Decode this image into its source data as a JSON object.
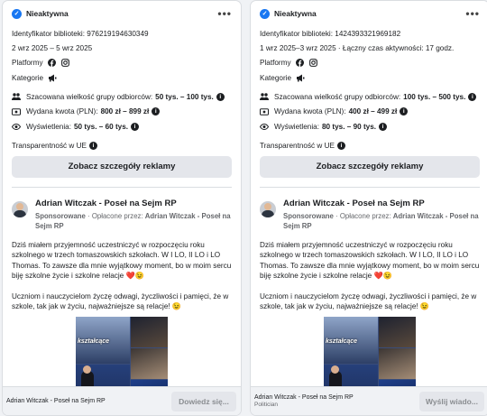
{
  "cards": [
    {
      "status": "Nieaktywna",
      "menu_label": "•••",
      "library_id": "Identyfikator biblioteki: 976219194630349",
      "dates": "2 wrz 2025 – 5 wrz 2025",
      "platforms_label": "Platformy",
      "categories_label": "Kategorie",
      "audience_label": "Szacowana wielkość grupy odbiorców:",
      "audience_value": "50 tys. – 100 tys.",
      "spend_label": "Wydana kwota (PLN):",
      "spend_value": "800 zł – 899 zł",
      "impressions_label": "Wyświetlenia:",
      "impressions_value": "50 tys. – 60 tys.",
      "transparency_label": "Transparentność w UE",
      "details_button": "Zobacz szczegóły reklamy",
      "post": {
        "author": "Adrian Witczak - Poseł na Sejm RP",
        "sponsored": "Sponsorowane",
        "paid_by_prefix": " · Opłacone przez: ",
        "paid_by": "Adrian Witczak - Poseł na Sejm RP",
        "paragraph1": "Dziś miałem przyjemność uczestniczyć w rozpoczęciu roku szkolnego w trzech tomaszowskich szkołach. W I LO, II LO i LO Thomas. To zawsze dla mnie wyjątkowy moment, bo w moim sercu biję szkolne życie i szkolne relacje ❤️😉",
        "paragraph2": "Uczniom i nauczycielom życzę odwagi, życzliwości i pamięci, że w szkole, tak jak w życiu, najważniejsze są relacje! 😉",
        "image_caption": "kształcące"
      },
      "footer": {
        "name": "Adrian Witczak - Poseł na Sejm RP",
        "sub": "",
        "button": "Dowiedz się..."
      }
    },
    {
      "status": "Nieaktywna",
      "menu_label": "•••",
      "library_id": "Identyfikator biblioteki: 1424393321969182",
      "dates": "1 wrz 2025–3 wrz 2025 · Łączny czas aktywności: 17 godz.",
      "platforms_label": "Platformy",
      "categories_label": "Kategorie",
      "audience_label": "Szacowana wielkość grupy odbiorców:",
      "audience_value": "100 tys. – 500 tys.",
      "spend_label": "Wydana kwota (PLN):",
      "spend_value": "400 zł – 499 zł",
      "impressions_label": "Wyświetlenia:",
      "impressions_value": "80 tys. – 90 tys.",
      "transparency_label": "Transparentność w UE",
      "details_button": "Zobacz szczegóły reklamy",
      "post": {
        "author": "Adrian Witczak - Poseł na Sejm RP",
        "sponsored": "Sponsorowane",
        "paid_by_prefix": " · Opłacone przez: ",
        "paid_by": "Adrian Witczak - Poseł na Sejm RP",
        "paragraph1": "Dziś miałem przyjemność uczestniczyć w rozpoczęciu roku szkolnego w trzech tomaszowskich szkołach. W I LO, II LO i LO Thomas. To zawsze dla mnie wyjątkowy moment, bo w moim sercu biję szkolne życie i szkolne relacje ❤️😉",
        "paragraph2": "Uczniom i nauczycielom życzę odwagi, życzliwości i pamięci, że w szkole, tak jak w życiu, najważniejsze są relacje! 😉",
        "image_caption": "kształcące"
      },
      "footer": {
        "name": "Adrian Witczak - Poseł na Sejm RP",
        "sub": "Politician",
        "button": "Wyślij wiado..."
      }
    }
  ],
  "icons": {
    "status": "check-badge-icon",
    "facebook": "facebook-icon",
    "instagram": "instagram-icon",
    "category": "megaphone-icon",
    "audience": "people-icon",
    "spend": "money-icon",
    "impressions": "eye-icon",
    "info": "info-icon"
  },
  "colors": {
    "accent": "#1877f2",
    "background": "#f0f2f5",
    "button": "#e4e6eb"
  }
}
